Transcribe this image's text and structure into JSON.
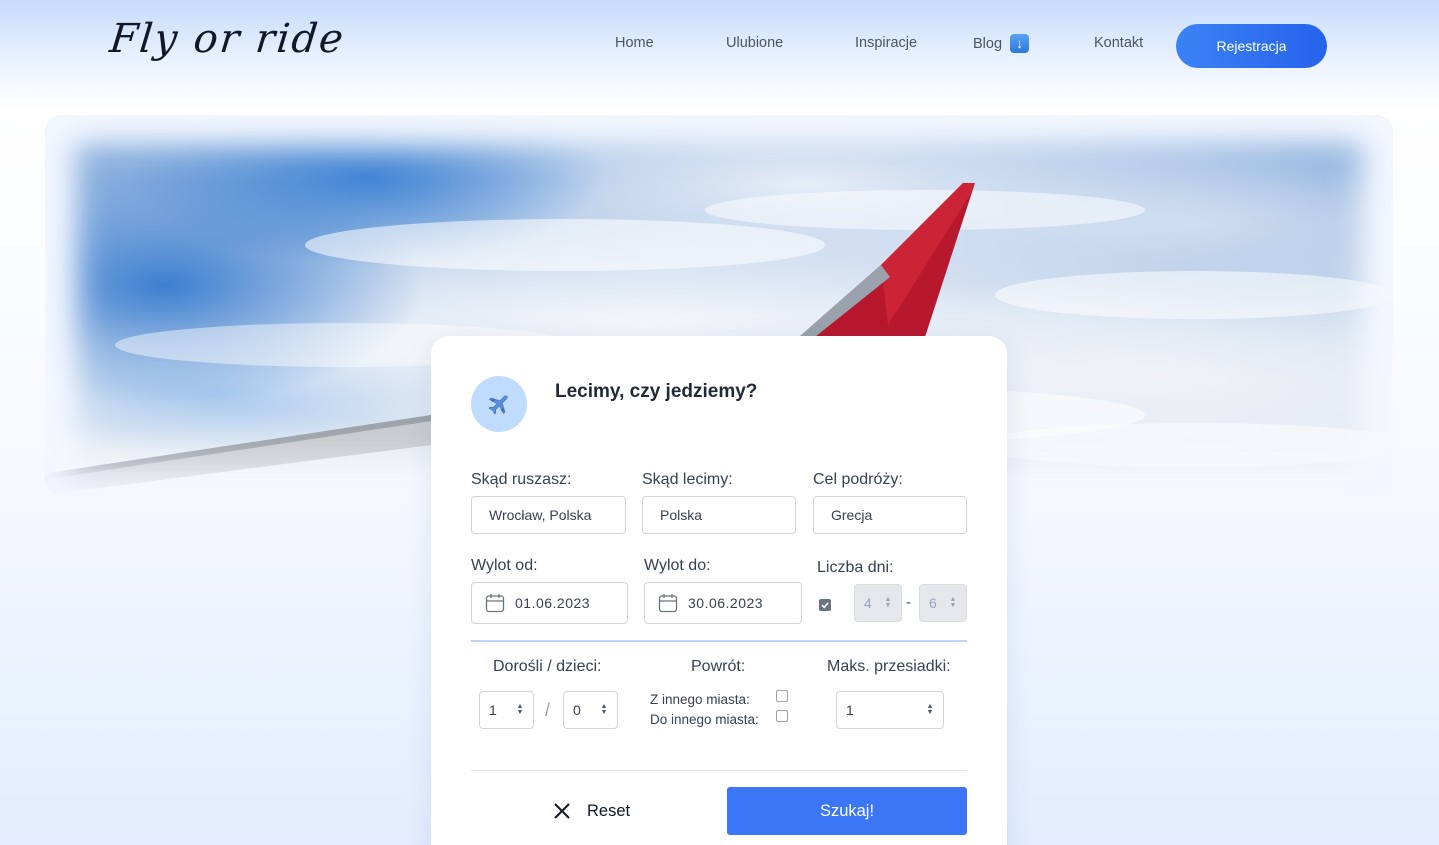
{
  "brand": {
    "logo_text": "Fly or ride"
  },
  "nav": {
    "home": "Home",
    "favorites": "Ulubione",
    "inspirations": "Inspiracje",
    "blog": "Blog",
    "contact": "Kontakt",
    "register": "Rejestracja"
  },
  "icons": {
    "blog_arrow": "arrow-down-icon",
    "card_icon": "airplane-icon",
    "calendar": "calendar-icon",
    "reset": "close-icon"
  },
  "colors": {
    "accent": "#3b76f6",
    "register_button": "#2563eb",
    "icon_circle": "#bfdbfe"
  },
  "search": {
    "title": "Lecimy, czy jedziemy?",
    "from_label": "Skąd ruszasz:",
    "from_value": "Wrocław, Polska",
    "fly_from_label": "Skąd lecimy:",
    "fly_from_value": "Polska",
    "destination_label": "Cel podróży:",
    "destination_value": "Grecja",
    "depart_from_label": "Wylot od:",
    "depart_from_value": "01.06.2023",
    "depart_to_label": "Wylot do:",
    "depart_to_value": "30.06.2023",
    "days_label": "Liczba dni:",
    "days_enabled": true,
    "days_min": "4",
    "days_separator": "-",
    "days_max": "6",
    "passengers_label": "Dorośli / dzieci:",
    "adults": "1",
    "passengers_separator": "/",
    "children": "0",
    "return_label": "Powrót:",
    "return_other_city_from": "Z innego miasta:",
    "return_other_city_from_checked": false,
    "return_other_city_to": "Do innego miasta:",
    "return_other_city_to_checked": false,
    "max_stops_label": "Maks. przesiadki:",
    "max_stops": "1",
    "reset_label": "Reset",
    "submit_label": "Szukaj!"
  }
}
